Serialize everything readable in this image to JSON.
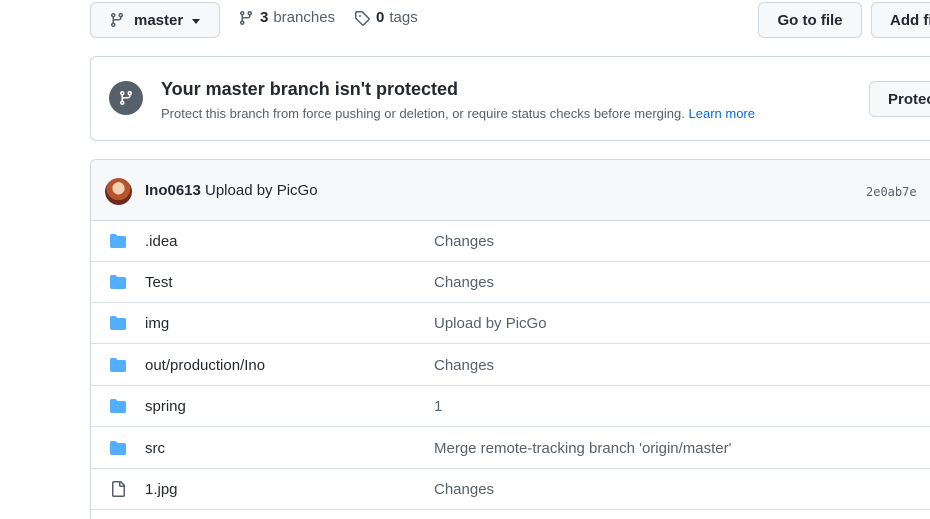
{
  "toolbar": {
    "branch_name": "master",
    "branches_count": "3",
    "branches_label": "branches",
    "tags_count": "0",
    "tags_label": "tags",
    "go_to_file_label": "Go to file",
    "add_file_label": "Add file"
  },
  "banner": {
    "title": "Your master branch isn't protected",
    "description": "Protect this branch from force pushing or deletion, or require status checks before merging.",
    "learn_more": "Learn more",
    "protect_label": "Protect"
  },
  "latest_commit": {
    "author": "Ino0613",
    "message": "Upload by PicGo",
    "sha": "2e0ab7e"
  },
  "files": [
    {
      "type": "folder",
      "name": ".idea",
      "message": "Changes"
    },
    {
      "type": "folder",
      "name": "Test",
      "message": "Changes"
    },
    {
      "type": "folder",
      "name": "img",
      "message": "Upload by PicGo"
    },
    {
      "type": "folder",
      "name": "out/production/Ino",
      "message": "Changes"
    },
    {
      "type": "folder",
      "name": "spring",
      "message": "1"
    },
    {
      "type": "folder",
      "name": "src",
      "message": "Merge remote-tracking branch 'origin/master'"
    },
    {
      "type": "file",
      "name": "1.jpg",
      "message": "Changes"
    }
  ],
  "colors": {
    "folder": "#54aeff",
    "link": "#0969da",
    "muted": "#57606a"
  }
}
